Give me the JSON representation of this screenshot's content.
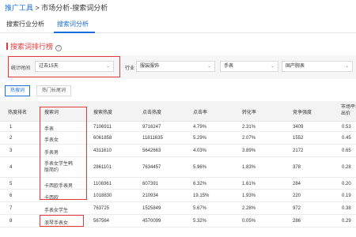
{
  "breadcrumb": {
    "link": "推广工具",
    "rest": " > 市场分析-搜索词分析"
  },
  "tabs": [
    {
      "label": "搜索行业分析",
      "active": false
    },
    {
      "label": "搜索词分析",
      "active": true
    }
  ],
  "section": {
    "title": "搜索词排行榜",
    "help_icon": "question-circle-icon"
  },
  "filters": {
    "time_label": "统计时间",
    "time_value": "过去15天",
    "industry_label": "行业",
    "industry_value": "服装服饰",
    "category_value": "手表",
    "subcategory_value": "国产腕表"
  },
  "sub_tabs": [
    {
      "label": "热搜词",
      "active": true
    },
    {
      "label": "热门长尾词",
      "active": false
    }
  ],
  "table": {
    "headers": [
      "热度排名",
      "搜索词",
      "搜索热度",
      "点击热度",
      "点击率",
      "转化率",
      "竞争强度",
      "市场平均出价"
    ],
    "rows": [
      [
        "1",
        "手表",
        "7106911",
        "9716247",
        "4.79%",
        "2.31%",
        "3409",
        "0.53"
      ],
      [
        "2",
        "手表女",
        "6061858",
        "11811635",
        "5.29%",
        "2.07%",
        "1552",
        "0.45"
      ],
      [
        "3",
        "手表男",
        "4311610",
        "5642663",
        "4.03%",
        "3.89%",
        "2172",
        "0.65"
      ],
      [
        "4",
        "手表女学生韩版简约",
        "2861101",
        "7634457",
        "5.96%",
        "1.83%",
        "378",
        "0.28"
      ],
      [
        "5",
        "卡西欧手表男",
        "1108361",
        "607391",
        "6.32%",
        "1.61%",
        "284",
        "0.20"
      ],
      [
        "6",
        "卡西欧",
        "1018830",
        "210934",
        "19.15%",
        "1.93%",
        "220",
        "0.19"
      ],
      [
        "7",
        "手表女学生",
        "763725",
        "1525849",
        "5.67%",
        "2.28%",
        "972",
        "0.38"
      ],
      [
        "8",
        "浪琴手表女",
        "567564",
        "4570099",
        "5.32%",
        "0.05%",
        "286",
        "0.29"
      ]
    ]
  },
  "colors": {
    "accent": "#1e6fd9",
    "highlight": "#e03a3a"
  }
}
